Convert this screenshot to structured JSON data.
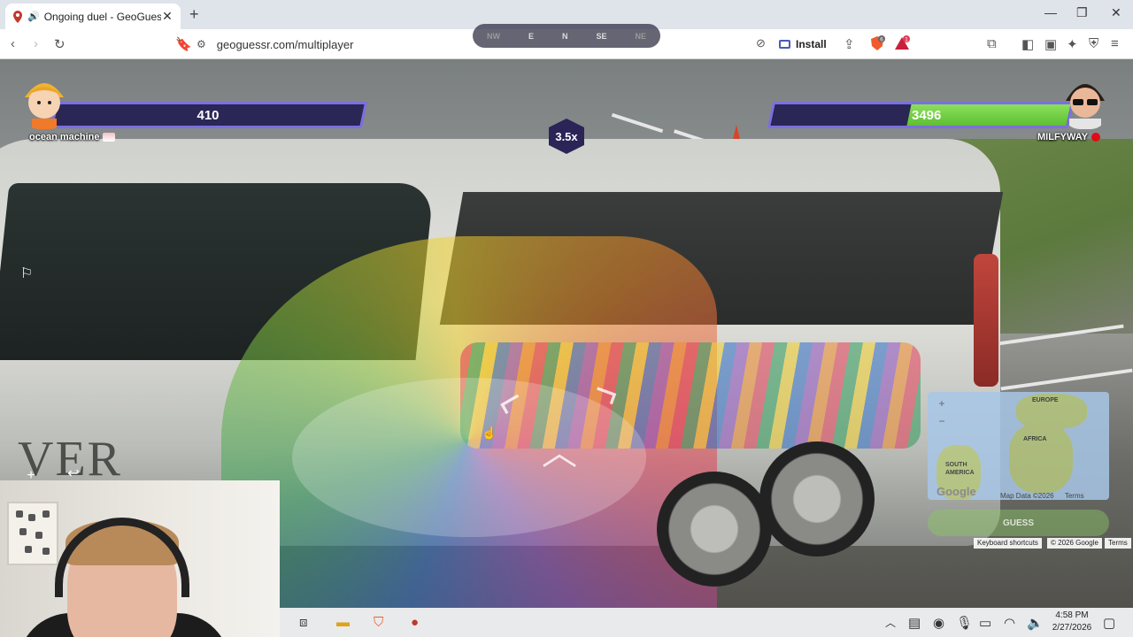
{
  "browser": {
    "tab_title": "Ongoing duel - GeoGuessr",
    "url": "geoguessr.com/multiplayer",
    "install_label": "Install",
    "new_tab": "+",
    "tab_close": "✕",
    "brave_count": "6",
    "alert_count": "1"
  },
  "hud": {
    "compass": [
      "NW",
      "E",
      "N",
      "SE",
      "NE"
    ],
    "multiplier": "3.5x",
    "player_left": {
      "health": "410",
      "name": "ocean machine",
      "health_fraction": 0.0
    },
    "player_right": {
      "health": "3496",
      "name": "MILFYWAY",
      "health_fraction": 0.54
    }
  },
  "minimap": {
    "labels": [
      "EUROPE",
      "AFRICA",
      "SOUTH AMERICA"
    ],
    "zoom_in": "+",
    "zoom_out": "−",
    "google": "Google",
    "map_data": "Map Data ©2026",
    "terms": "Terms",
    "guess_label": "GUESS",
    "keyboard_shortcuts": "Keyboard shortcuts",
    "copyright": "© 2026 Google",
    "terms2": "Terms"
  },
  "streetview": {
    "vehicle_text": "VER"
  },
  "taskbar": {
    "time": "4:58 PM",
    "date": "2/27/2026"
  },
  "colors": {
    "health_green": "#6fd03f",
    "health_bar_bg": "#2a2656",
    "health_border": "#7b6fe0"
  }
}
